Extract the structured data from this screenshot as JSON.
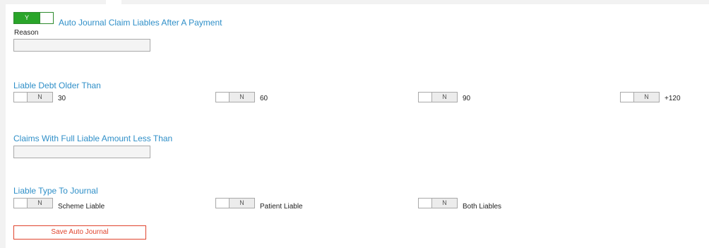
{
  "auto_journal": {
    "toggle_value": "Y",
    "label": "Auto Journal Claim Liables After A Payment",
    "reason_label": "Reason",
    "reason_value": ""
  },
  "debt_older": {
    "heading": "Liable Debt Older Than",
    "options": [
      {
        "toggle_value": "N",
        "label": "30"
      },
      {
        "toggle_value": "N",
        "label": "60"
      },
      {
        "toggle_value": "N",
        "label": "90"
      },
      {
        "toggle_value": "N",
        "label": "+120"
      }
    ]
  },
  "full_liable": {
    "heading": "Claims With Full Liable Amount Less Than",
    "value": ""
  },
  "liable_type": {
    "heading": "Liable Type To Journal",
    "options": [
      {
        "toggle_value": "N",
        "label": "Scheme Liable"
      },
      {
        "toggle_value": "N",
        "label": "Patient Liable"
      },
      {
        "toggle_value": "N",
        "label": "Both Liables"
      }
    ]
  },
  "save_label": "Save Auto Journal",
  "colors": {
    "accent_blue": "#2f8fc8",
    "toggle_on": "#2aa52a",
    "save_red": "#e0452e"
  }
}
